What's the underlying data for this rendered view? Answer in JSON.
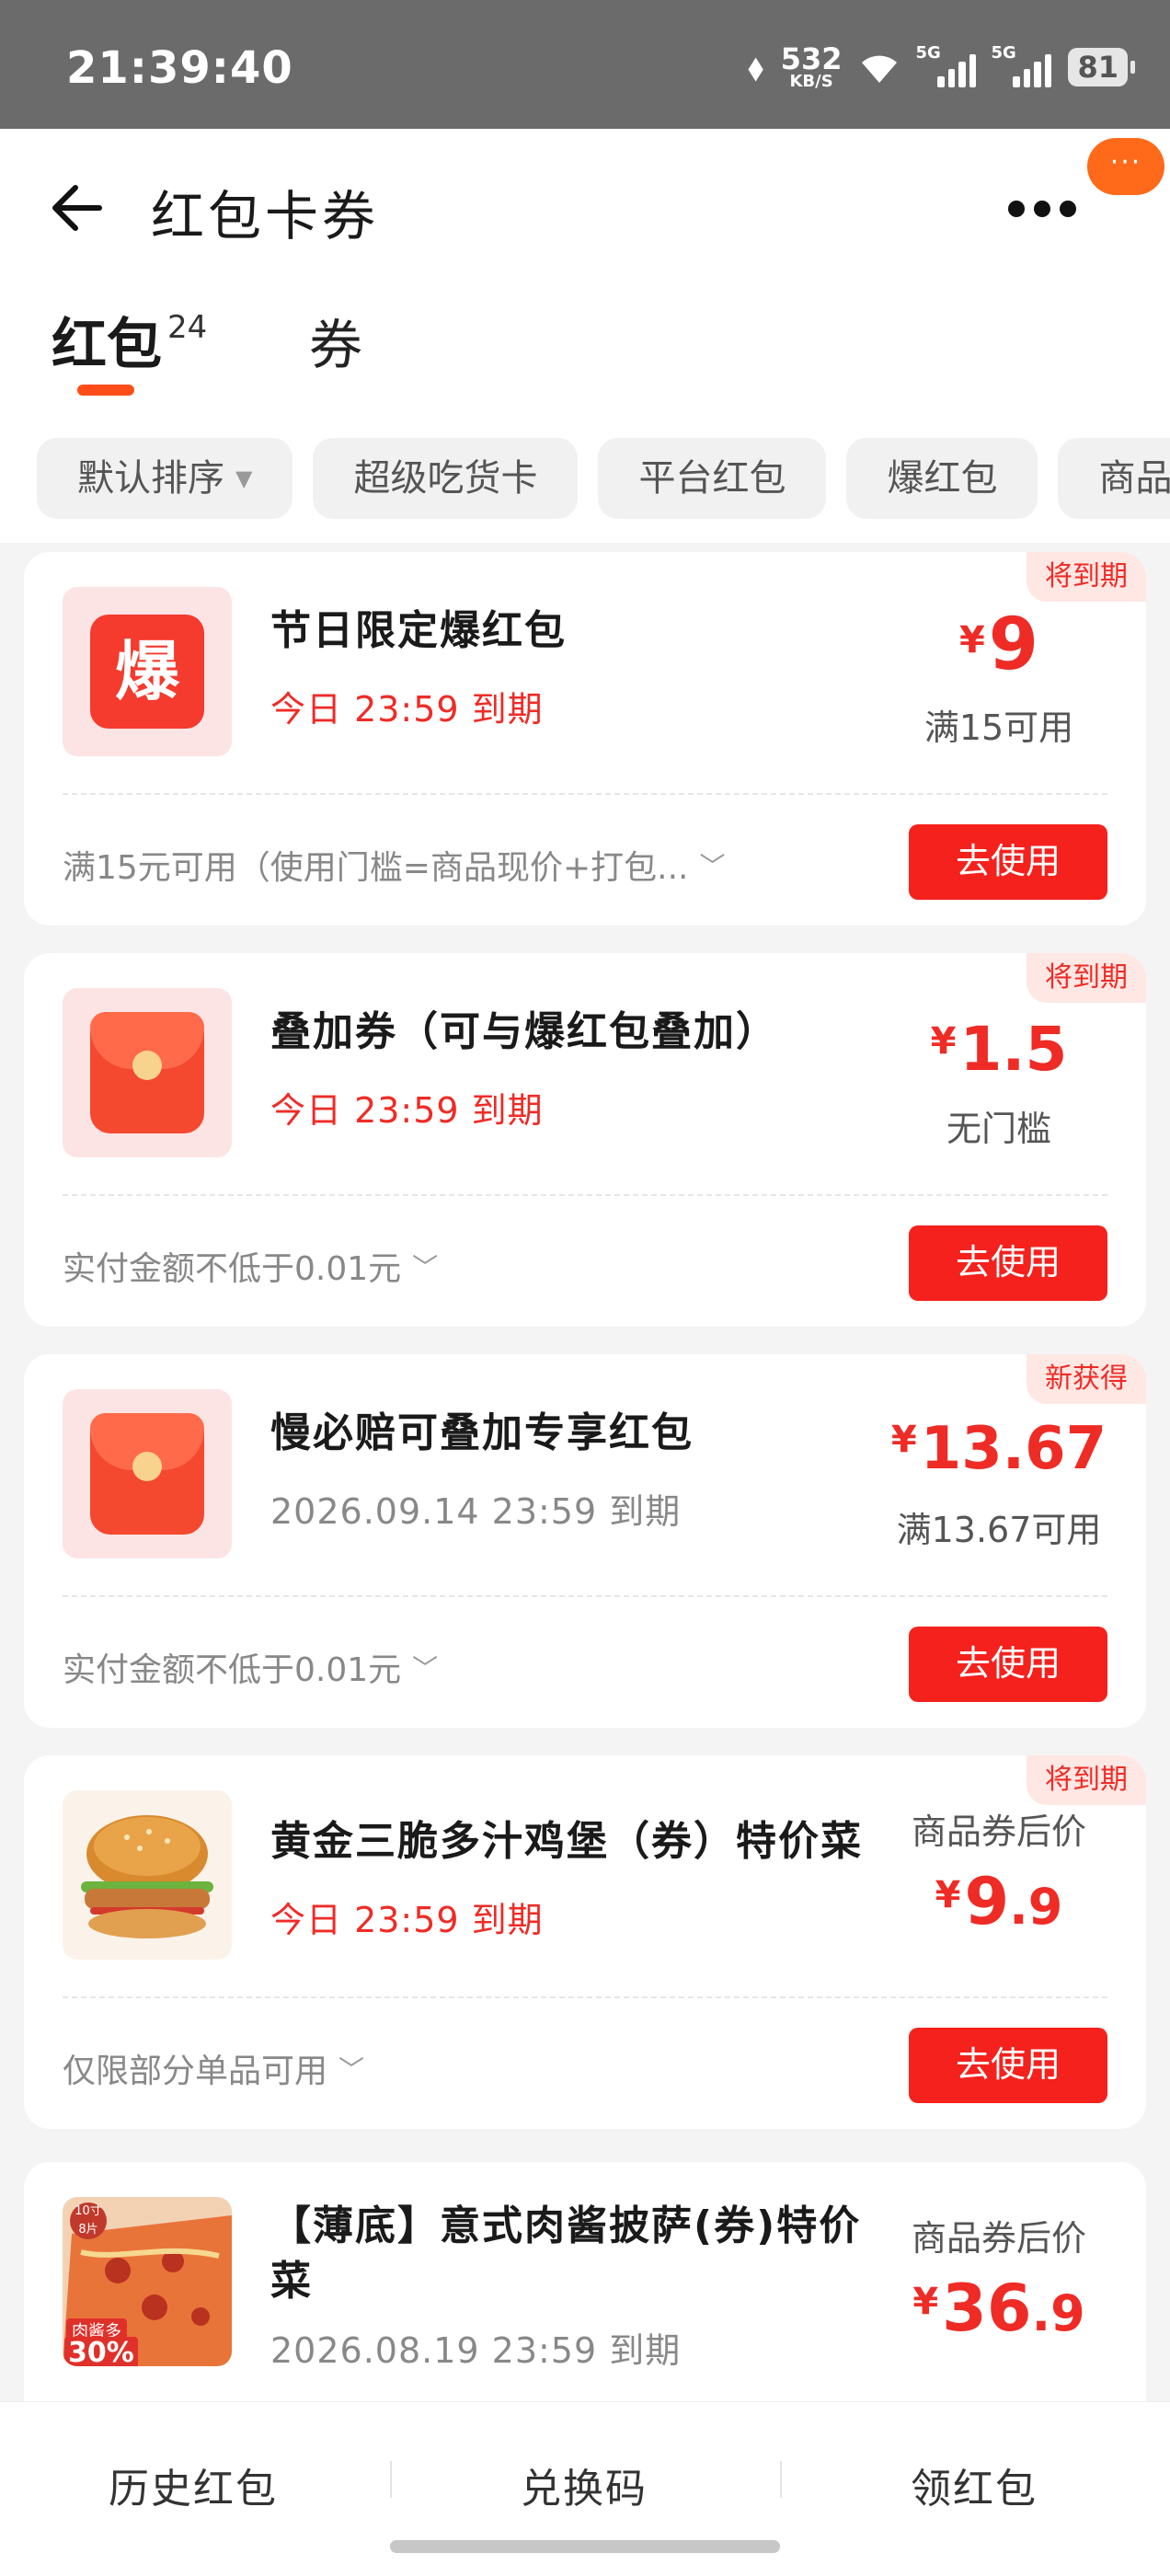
{
  "status": {
    "time": "21:39:40",
    "speed_num": "532",
    "speed_unit": "KB/S",
    "sig1_label": "5G",
    "sig2_label": "5G",
    "battery": "81"
  },
  "header": {
    "title": "红包卡券",
    "capsule": "···"
  },
  "tabs": {
    "hongbao": "红包",
    "hongbao_count": "24",
    "coupon": "券"
  },
  "filters": [
    "默认排序",
    "超级吃货卡",
    "平台红包",
    "爆红包",
    "商品"
  ],
  "cards": [
    {
      "tag": "将到期",
      "thumb_text": "爆",
      "title": "节日限定爆红包",
      "expire": "今日 23:59 到期",
      "currency": "¥",
      "amount_int": "9",
      "amount_dec": "",
      "condition": "满15可用",
      "rule": "满15元可用（使用门槛=商品现价+打包...",
      "button": "去使用"
    },
    {
      "tag": "将到期",
      "title": "叠加券（可与爆红包叠加）",
      "expire": "今日 23:59 到期",
      "currency": "¥",
      "amount_int": "1.5",
      "amount_dec": "",
      "condition": "无门槛",
      "rule": "实付金额不低于0.01元",
      "button": "去使用"
    },
    {
      "tag": "新获得",
      "title": "慢必赔可叠加专享红包",
      "expire": "2026.09.14 23:59 到期",
      "currency": "¥",
      "amount_int": "13.67",
      "amount_dec": "",
      "condition": "满13.67可用",
      "rule": "实付金额不低于0.01元",
      "button": "去使用"
    },
    {
      "tag": "将到期",
      "pre_label": "商品券后价",
      "title": "黄金三脆多汁鸡堡（券）特价菜",
      "expire": "今日 23:59 到期",
      "currency": "¥",
      "amount_int": "9",
      "amount_dec": ".9",
      "rule": "仅限部分单品可用",
      "button": "去使用"
    },
    {
      "pre_label": "商品券后价",
      "title_line1": "【薄底】意式肉酱披萨(券)特价",
      "title_line2": "菜",
      "expire": "2026.08.19 23:59 到期",
      "currency": "¥",
      "amount_int": "36",
      "amount_dec": ".9",
      "thumb_badge": "30%",
      "thumb_label": "肉酱多",
      "thumb_size": "10寸 8片"
    }
  ],
  "bottom_nav": [
    "历史红包",
    "兑换码",
    "领红包"
  ],
  "colors": {
    "accent": "#ef2b26",
    "button": "#f5211d",
    "tab_indicator": "#ff4d1a",
    "capsule": "#ff6a1a"
  }
}
